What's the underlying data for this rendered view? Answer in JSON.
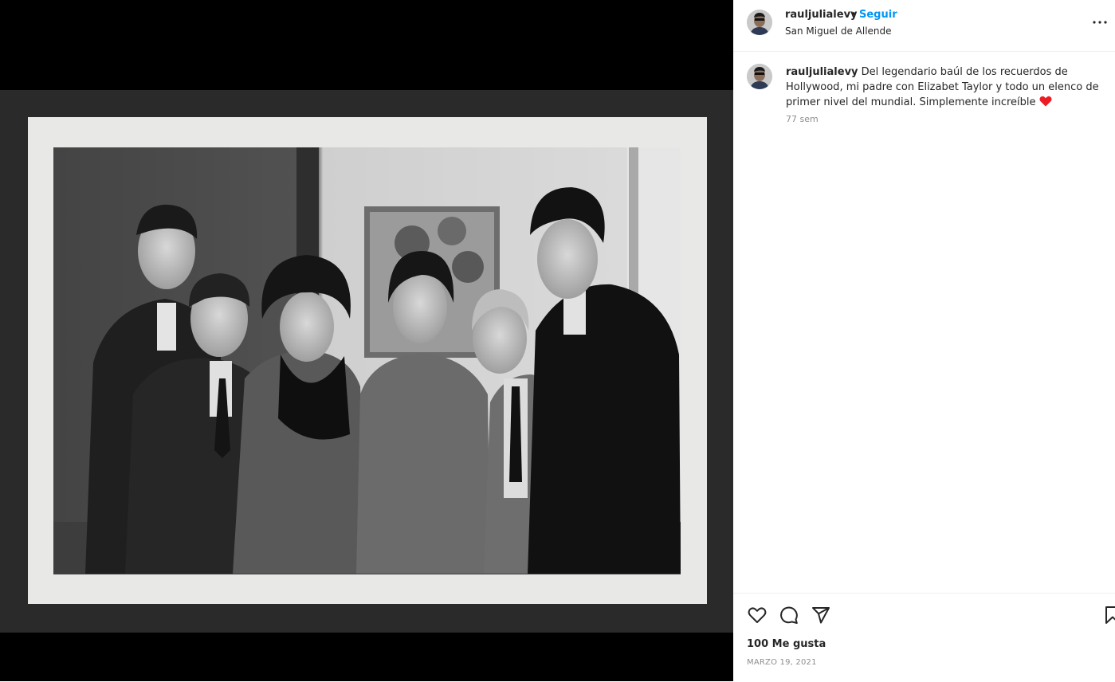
{
  "header": {
    "username": "rauljulialevy",
    "separator": "•",
    "follow_label": "Seguir",
    "location": "San Miguel de Allende",
    "more_icon": "more-horizontal-icon"
  },
  "caption": {
    "username": "rauljulialevy",
    "text": "Del legendario baúl de los recuerdos de Hollywood, mi padre con Elizabet Taylor y todo un elenco de primer nivel del mundial. Simplemente increíble",
    "emoji": "red-heart-icon",
    "time_ago": "77 sem"
  },
  "actions": {
    "icons": [
      "heart-icon",
      "comment-icon",
      "share-icon",
      "bookmark-icon"
    ],
    "likes": "100 Me gusta",
    "date": "MARZO 19, 2021"
  },
  "media": {
    "description_icon": "post-photo"
  },
  "colors": {
    "accent": "#0095f6",
    "heart": "#ed1c24",
    "muted": "#8e8e8e",
    "text": "#262626"
  }
}
